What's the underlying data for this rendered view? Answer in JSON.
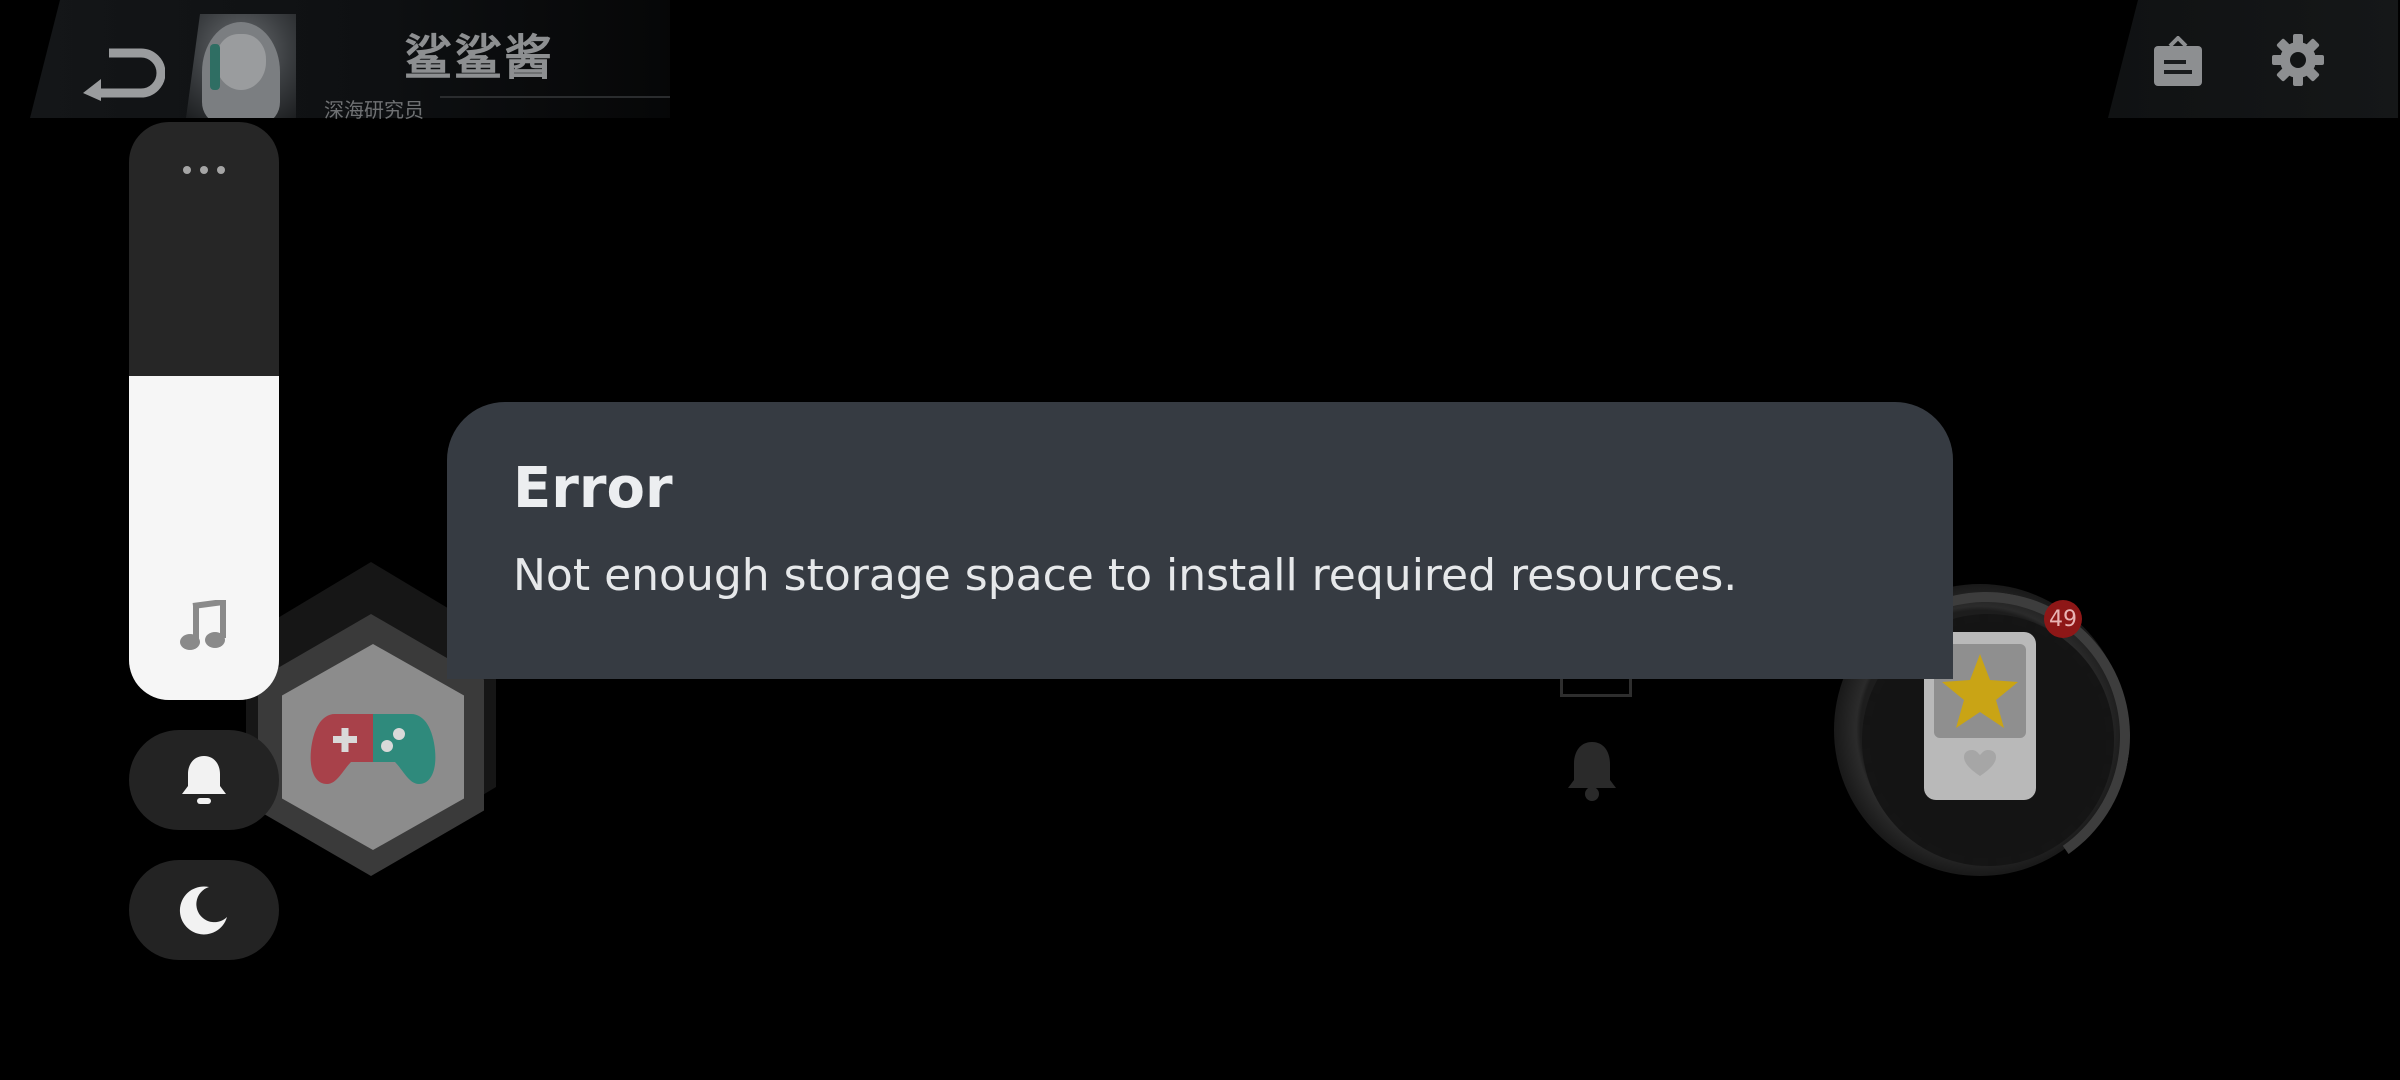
{
  "header": {
    "player_name": "鲨鲨酱",
    "player_title": "深海研究员",
    "back_icon": "back-arrow-icon",
    "mail_icon": "mail-icon",
    "settings_icon": "gear-icon"
  },
  "system_overlay": {
    "volume_level": 0.56,
    "volume_icon": "music-note-icon",
    "more_icon": "more-dots-icon",
    "notify_icon": "bell-icon",
    "dnd_icon": "moon-icon"
  },
  "game_hud": {
    "gamepad_icon": "gamepad-icon",
    "badge_count": "49"
  },
  "dialog": {
    "title": "Error",
    "message": "Not enough storage space to install required resources."
  },
  "colors": {
    "dialog_bg": "#363b42",
    "badge_bg": "#8e1717",
    "gamepad_left": "#a8414a",
    "gamepad_right": "#2f8a7c",
    "star": "#c9a415"
  }
}
